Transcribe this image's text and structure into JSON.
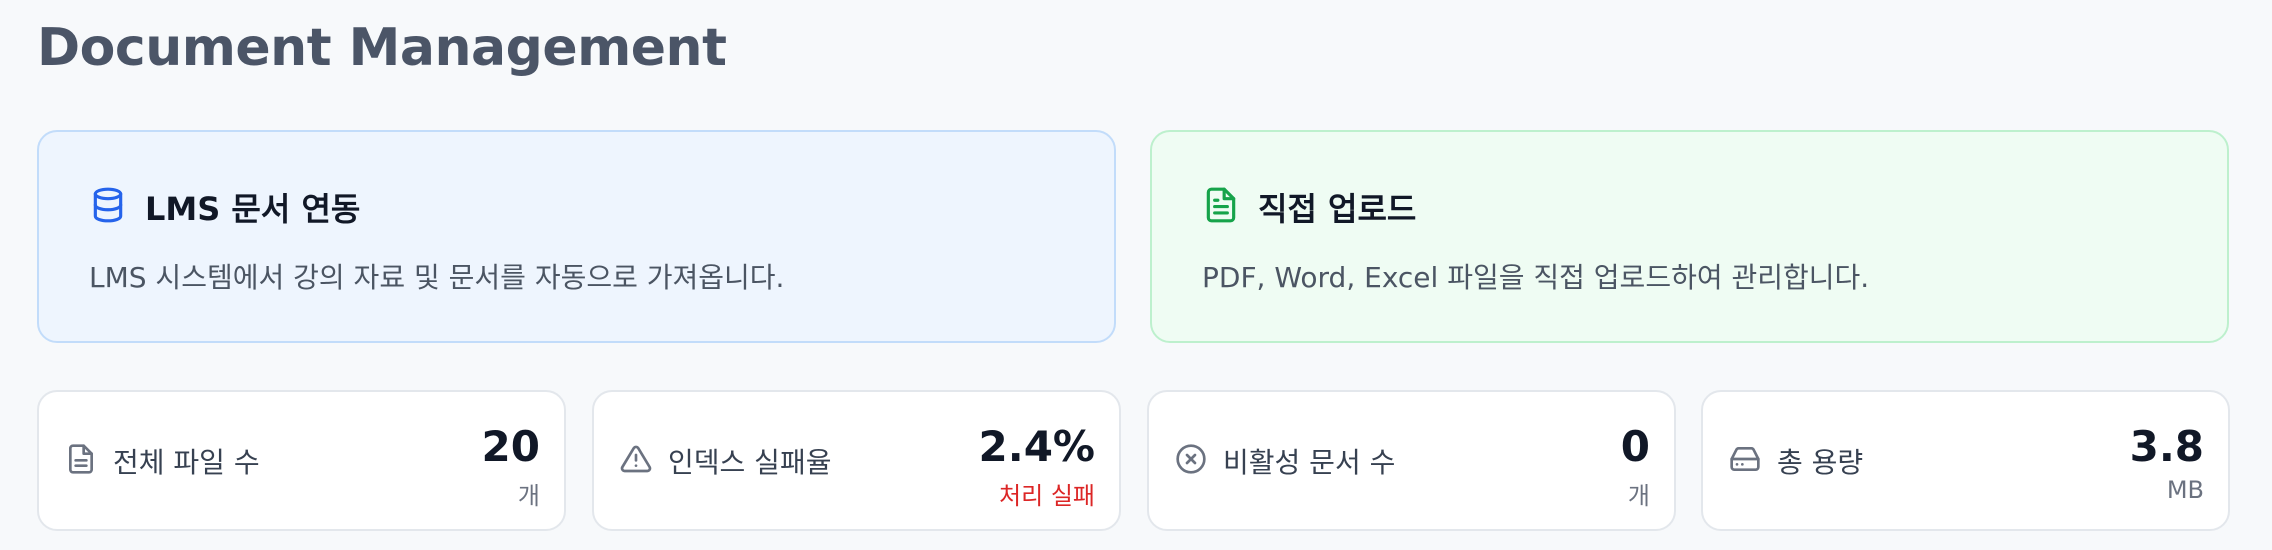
{
  "page": {
    "title": "Document Management"
  },
  "info_cards": [
    {
      "icon": "database-icon",
      "title": "LMS 문서 연동",
      "description": "LMS 시스템에서 강의 자료 및 문서를 자동으로 가져옵니다.",
      "accent": "#2563eb"
    },
    {
      "icon": "file-text-icon",
      "title": "직접 업로드",
      "description": "PDF, Word, Excel 파일을 직접 업로드하여 관리합니다.",
      "accent": "#16a34a"
    }
  ],
  "stats": [
    {
      "icon": "file-text-icon",
      "label": "전체 파일 수",
      "value": "20",
      "sub": "개"
    },
    {
      "icon": "alert-triangle-icon",
      "label": "인덱스 실패율",
      "value": "2.4%",
      "sub": "처리 실패",
      "sub_color": "#dc2626"
    },
    {
      "icon": "x-circle-icon",
      "label": "비활성 문서 수",
      "value": "0",
      "sub": "개"
    },
    {
      "icon": "hard-drive-icon",
      "label": "총 용량",
      "value": "3.8",
      "sub": "MB"
    }
  ]
}
